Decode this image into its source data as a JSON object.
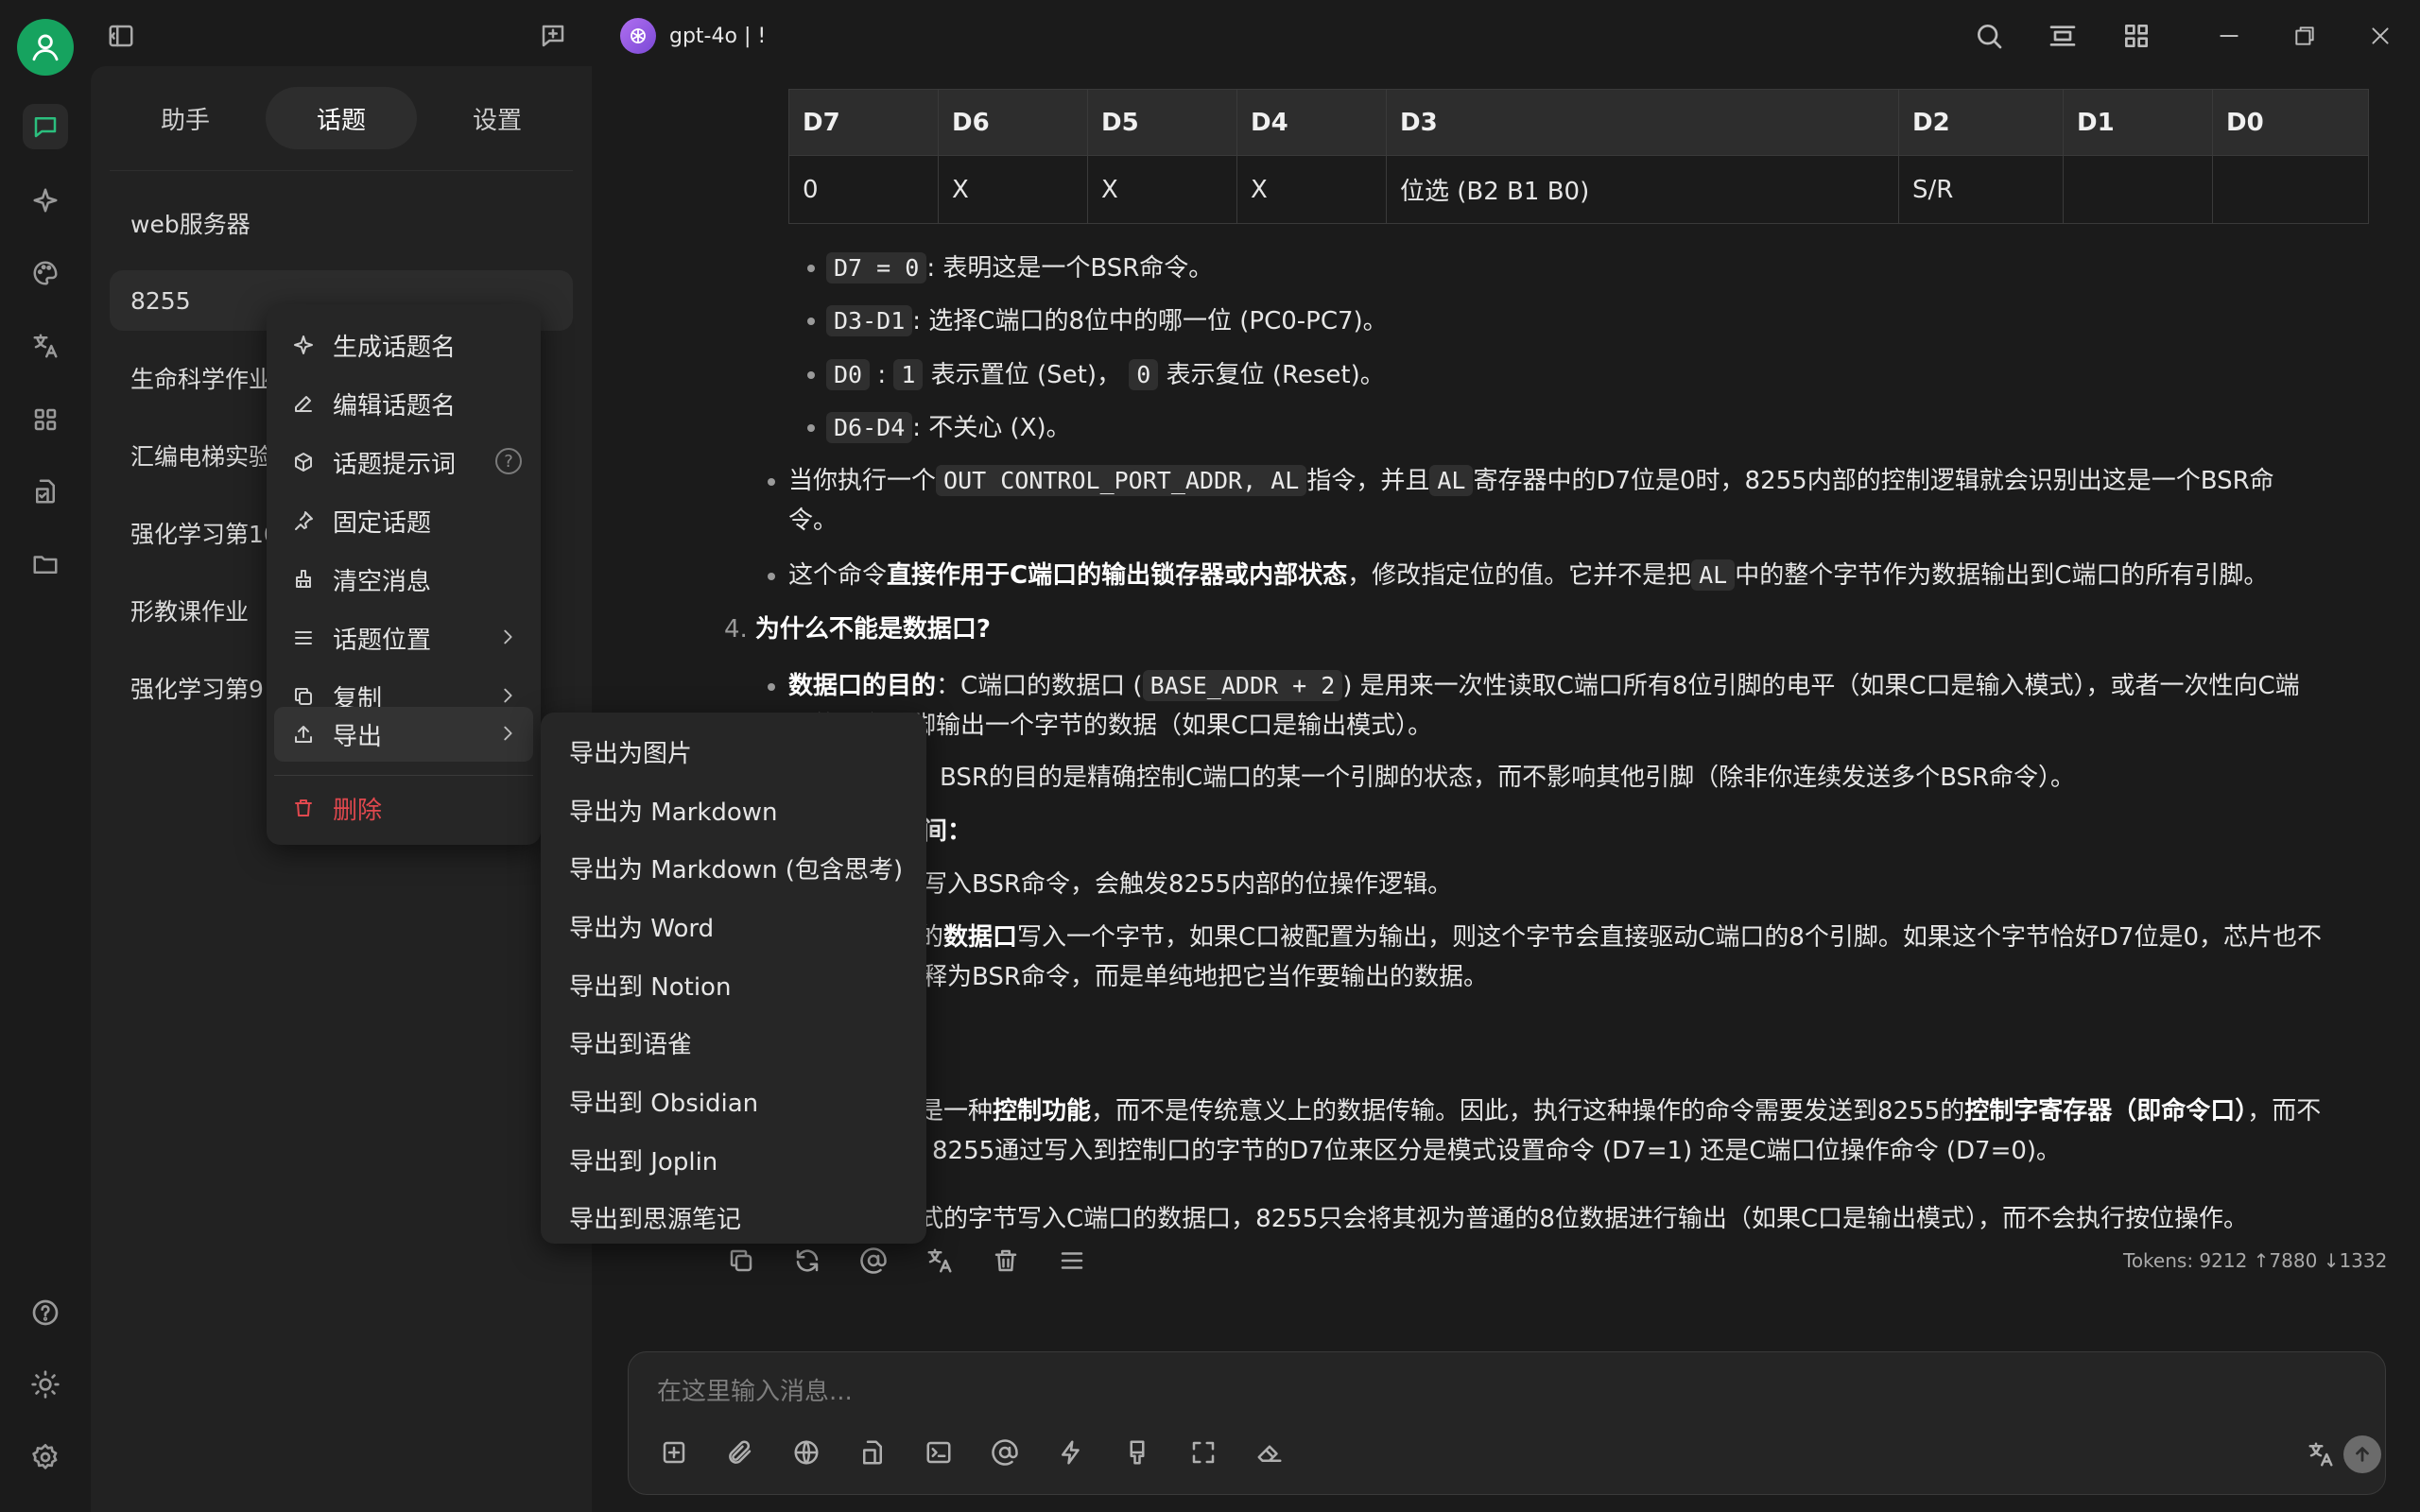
{
  "window": {
    "model_name": "gpt-4o | !",
    "controls": [
      "search-icon",
      "layout-icon",
      "grid-icon",
      "minimize-icon",
      "restore-icon",
      "close-icon"
    ]
  },
  "rail": {
    "icons": [
      "user-avatar-icon",
      "chat-icon",
      "sparkle-icon",
      "palette-icon",
      "translate-icon",
      "apps-icon",
      "file-check-icon",
      "folder-icon",
      "help-icon",
      "theme-icon",
      "settings-icon"
    ]
  },
  "panel": {
    "tabs": [
      "助手",
      "话题",
      "设置"
    ],
    "active_tab": "话题",
    "topics": [
      "web服务器",
      "8255",
      "生命科学作业",
      "汇编电梯实验",
      "强化学习第10",
      "形教课作业",
      "强化学习第9"
    ]
  },
  "context_menu": {
    "items": [
      {
        "label": "生成话题名",
        "icon": "sparkle-icon"
      },
      {
        "label": "编辑话题名",
        "icon": "pencil-icon"
      },
      {
        "label": "话题提示词",
        "icon": "cube-icon"
      },
      {
        "label": "固定话题",
        "icon": "pin-icon"
      },
      {
        "label": "清空消息",
        "icon": "broom-icon"
      },
      {
        "label": "话题位置",
        "icon": "menu-icon"
      },
      {
        "label": "复制",
        "icon": "copy-icon"
      },
      {
        "label": "导出",
        "icon": "export-icon"
      },
      {
        "label": "删除",
        "icon": "trash-icon"
      }
    ],
    "help_glyph": "?"
  },
  "export_submenu": {
    "items": [
      "导出为图片",
      "导出为 Markdown",
      "导出为 Markdown (包含思考)",
      "导出为 Word",
      "导出到 Notion",
      "导出到语雀",
      "导出到 Obsidian",
      "导出到 Joplin",
      "导出到思源笔记"
    ]
  },
  "table": {
    "headers": [
      "D7",
      "D6",
      "D5",
      "D4",
      "D3",
      "D2",
      "D1",
      "D0"
    ],
    "row": [
      "0",
      "X",
      "X",
      "X",
      "位选 (B2 B1 B0)",
      "S/R",
      "",
      ""
    ]
  },
  "content": {
    "b1_code": "D7 = 0",
    "b1_text": ": 表明这是一个BSR命令。",
    "b2_code": "D3-D1",
    "b2_text": ": 选择C端口的8位中的哪一位 (PC0-PC7)。",
    "b3_code1": "D0",
    "b3_sep": ":",
    "b3_code2": "1",
    "b3_text1": "表示置位 (Set)，",
    "b3_code3": "0",
    "b3_text2": "表示复位 (Reset)。",
    "b4_code": "D6-D4",
    "b4_text": ": 不关心 (X)。",
    "p1_a": "当你执行一个",
    "p1_code": "OUT CONTROL_PORT_ADDR, AL",
    "p1_b": "指令，并且",
    "p1_code2": "AL",
    "p1_c": "寄存器中的D7位是0时，8255内部的控制逻辑就会识别出这是一个BSR命",
    "p1_d": "令。",
    "p2_a": "这个命令",
    "p2_bold": "直接作用于C端口的输出锁存器或内部状态",
    "p2_b": "，修改指定位的值。它并不是把",
    "p2_code": "AL",
    "p2_c": "中的整个字节作为数据输出到C端口的所有引脚。",
    "h4_num": "4.",
    "h4_text": "为什么不能是数据口?",
    "p3_bold": "数据口的目的",
    "p3_a": "：C端口的数据口 (",
    "p3_code": "BASE_ADDR + 2",
    "p3_b": ") 是用来一次性读取C端口所有8位引脚的电平（如果C口是输入模式），或者一次性向C端",
    "p3_c": "口的所有引脚输出一个字节的数据（如果C口是输出模式）。",
    "p4": "BSR的目的是精确控制C端口的某一个引脚的状态，而不影响其他引脚（除非你连续发送多个BSR命令）。",
    "p5": "间：",
    "p6": "写入BSR命令，会触发8255内部的位操作逻辑。",
    "p7_a": "的",
    "p7_bold": "数据口",
    "p7_b": "写入一个字节，如果C口被配置为输出，则这个字节会直接驱动C端口的8个引脚。如果这个字节恰好D7位是0，芯片也不",
    "p7_c": "释为BSR命令，而是单纯地把它当作要输出的数据。",
    "p8_a": "是一种",
    "p8_bold": "控制功能",
    "p8_b": "，而不是传统意义上的数据传输。因此，执行这种操作的命令需要发送到8255的",
    "p8_bold2": "控制字寄存器（即命令口）",
    "p8_c": "，而不",
    "p8_d": "8255通过写入到控制口的字节的D7位来区分是模式设置命令 (D7=1) 还是C端口位操作命令 (D7=0)。",
    "p9": "式的字节写入C端口的数据口，8255只会将其视为普通的8位数据进行输出（如果C口是输出模式），而不会执行按位操作。"
  },
  "message_footer": {
    "tokens": "Tokens: 9212 ↑7880 ↓1332"
  },
  "input": {
    "placeholder": "在这里输入消息..."
  },
  "colors": {
    "accent": "#2bbf7e",
    "danger": "#e0484e",
    "background": "#1b1b1b",
    "panel": "#222222"
  }
}
